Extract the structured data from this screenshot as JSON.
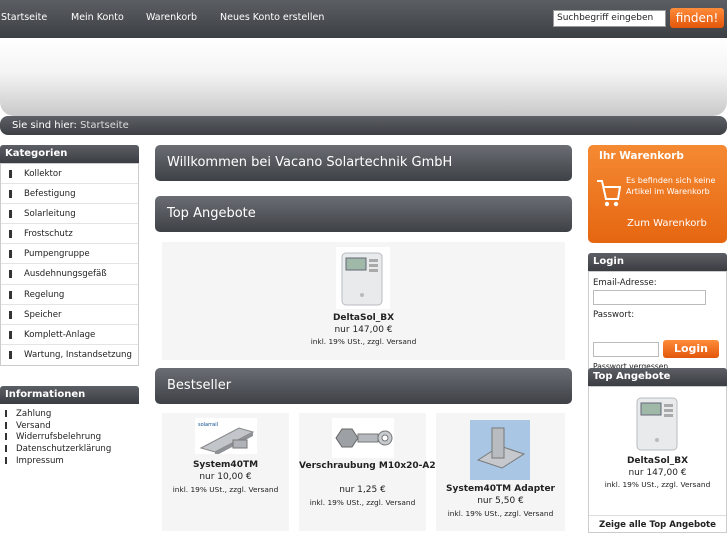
{
  "nav": [
    "Startseite",
    "Mein Konto",
    "Warenkorb",
    "Neues Konto erstellen"
  ],
  "search": {
    "placeholder": "Suchbegriff eingeben",
    "button": "finden!"
  },
  "breadcrumb": {
    "prefix": "Sie sind hier:",
    "link": "Startseite"
  },
  "categories": {
    "title": "Kategorien",
    "items": [
      "Kollektor",
      "Befestigung",
      "Solarleitung",
      "Frostschutz",
      "Pumpengruppe",
      "Ausdehnungsgefäß",
      "Regelung",
      "Speicher",
      "Komplett-Anlage",
      "Wartung, Instandsetzung"
    ]
  },
  "informationen": {
    "title": "Informationen",
    "items": [
      "Zahlung",
      "Versand",
      "Widerrufsbelehrung",
      "Datenschutzerklärung",
      "Impressum"
    ]
  },
  "center": {
    "welcome": "Willkommen bei Vacano Solartechnik GmbH",
    "top_title": "Top Angebote",
    "top_product": {
      "name": "DeltaSol_BX",
      "price": "nur 147,00 €",
      "tax": "inkl. 19% USt., zzgl. Versand"
    },
    "bestseller_title": "Bestseller",
    "bestsellers": [
      {
        "name": "System40TM",
        "price": "nur 10,00 €",
        "tax": "inkl. 19% USt., zzgl. Versand"
      },
      {
        "name": "Verschraubung M10x20-A2",
        "price": "nur 1,25 €",
        "tax": "inkl. 19% USt., zzgl. Versand"
      },
      {
        "name": "System40TM Adapter",
        "price": "nur 5,50 €",
        "tax": "inkl. 19% USt., zzgl. Versand"
      }
    ]
  },
  "cart": {
    "title": "Ihr Warenkorb",
    "text": "Es befinden sich keine Artikel im Warenkorb",
    "link": "Zum Warenkorb"
  },
  "login": {
    "title": "Login",
    "email_label": "Email-Adresse:",
    "password_label": "Passwort:",
    "button": "Login",
    "forgot": "Passwort vergessen"
  },
  "sidebar_top": {
    "title": "Top Angebote",
    "product": {
      "name": "DeltaSol_BX",
      "price": "nur 147,00 €",
      "tax": "inkl. 19% USt., zzgl. Versand"
    },
    "all_link": "Zeige alle Top Angebote"
  },
  "colors": {
    "accent": "#e8671a",
    "dark": "#44474c"
  }
}
